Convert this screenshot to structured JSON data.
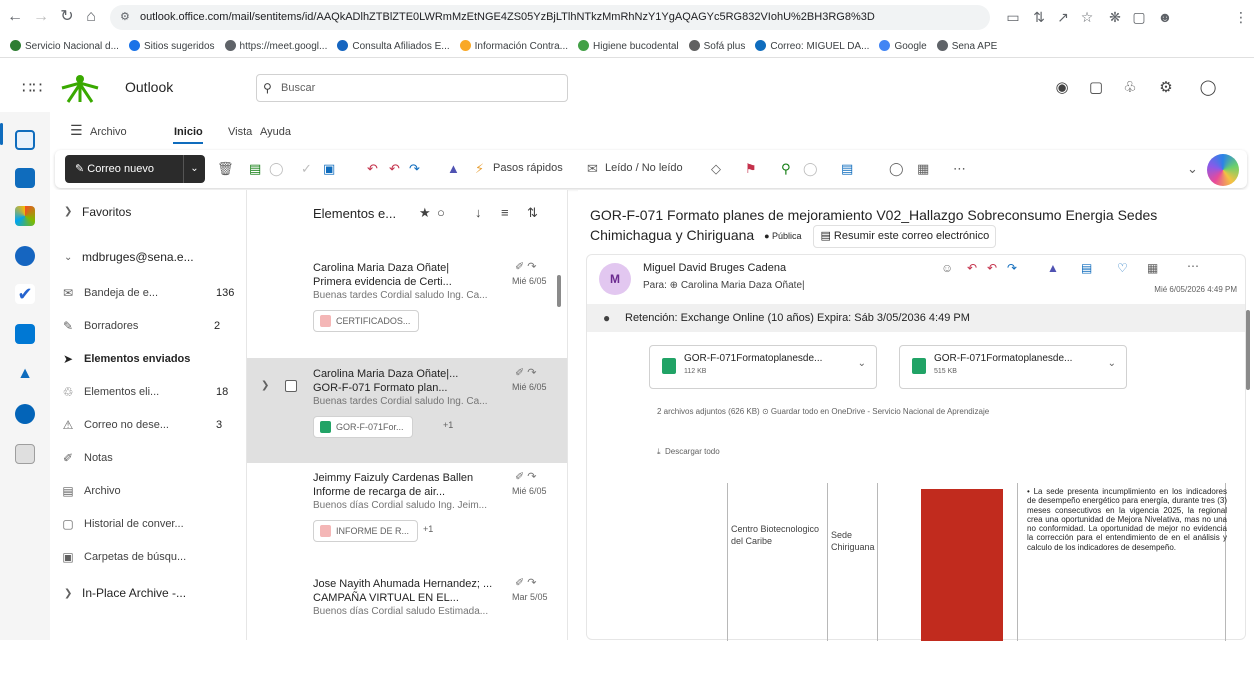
{
  "browser": {
    "url": "outlook.office.com/mail/sentitems/id/AAQkADlhZTBlZTE0LWRmMzEtNGE4ZS05YzBjLTlhNTkzMmRhNzY1YgAQAGYc5RG832VIohU%2BH3RG8%3D",
    "bookmarks": [
      {
        "label": "Servicio Nacional d...",
        "color": "#2e7d32"
      },
      {
        "label": "Sitios sugeridos",
        "color": "#1a73e8"
      },
      {
        "label": "https://meet.googl...",
        "color": "#5f6368"
      },
      {
        "label": "Consulta Afiliados E...",
        "color": "#1565c0"
      },
      {
        "label": "Información Contra...",
        "color": "#f9a825"
      },
      {
        "label": "Higiene bucodental",
        "color": "#43a047"
      },
      {
        "label": "Sofá plus",
        "color": "#616161"
      },
      {
        "label": "Correo: MIGUEL DA...",
        "color": "#0f6cbd"
      },
      {
        "label": "Google",
        "color": "#4285f4"
      },
      {
        "label": "Sena APE",
        "color": "#5f6368"
      }
    ]
  },
  "header": {
    "app_name": "Outlook",
    "search_placeholder": "Buscar"
  },
  "ribbon": {
    "tabs": [
      "Archivo",
      "Inicio",
      "Vista",
      "Ayuda"
    ],
    "new_mail": "Correo nuevo",
    "quick_steps": "Pasos rápidos",
    "read_unread": "Leído / No leído"
  },
  "folders": {
    "favorites": "Favoritos",
    "account": "mdbruges@sena.e...",
    "items": [
      {
        "label": "Bandeja de e...",
        "count": "136",
        "icon": "inbox-icon"
      },
      {
        "label": "Borradores",
        "count": "2",
        "icon": "drafts-icon"
      },
      {
        "label": "Elementos enviados",
        "count": "",
        "icon": "sent-icon"
      },
      {
        "label": "Elementos eli...",
        "count": "18",
        "icon": "trash-icon"
      },
      {
        "label": "Correo no dese...",
        "count": "3",
        "icon": "junk-icon"
      },
      {
        "label": "Notas",
        "count": "",
        "icon": "notes-icon"
      },
      {
        "label": "Archivo",
        "count": "",
        "icon": "archive-icon"
      },
      {
        "label": "Historial de conver...",
        "count": "",
        "icon": "history-icon"
      },
      {
        "label": "Carpetas de búsqu...",
        "count": "",
        "icon": "search-folder-icon"
      }
    ],
    "archive": "In-Place Archive -..."
  },
  "message_list": {
    "title": "Elementos e...",
    "messages": [
      {
        "from": "Carolina Maria Daza Oñate|",
        "subject": "Primera evidencia de Certi...",
        "date": "Mié 6/05",
        "preview": "Buenas tardes Cordial saludo Ing. Ca...",
        "attachment": "CERTIFICADOS...",
        "more": ""
      },
      {
        "from": "Carolina Maria Daza Oñate|...",
        "subject": "GOR-F-071 Formato plan...",
        "date": "Mié 6/05",
        "preview": "Buenas tardes Cordial saludo Ing. Ca...",
        "attachment": "GOR-F-071For...",
        "more": "+1"
      },
      {
        "from": "Jeimmy Faizuly Cardenas Ballen",
        "subject": "Informe de recarga de air...",
        "date": "Mié 6/05",
        "preview": "Buenos días Cordial saludo Ing. Jeim...",
        "attachment": "INFORME DE R...",
        "more": "+1"
      },
      {
        "from": "Jose Nayith Ahumada Hernandez; ...",
        "subject": "CAMPAÑA VIRTUAL EN EL...",
        "date": "Mar 5/05",
        "preview": "Buenos días Cordial saludo Estimada...",
        "attachment": "",
        "more": ""
      }
    ]
  },
  "reading": {
    "subject": "GOR-F-071 Formato planes de mejoramiento V02_Hallazgo Sobreconsumo Energia Sedes Chimichagua y  Chiriguana",
    "label": "Pública",
    "summarize": "Resumir este correo electrónico",
    "avatar_initial": "M",
    "sender": "Miguel David Bruges Cadena",
    "to": "Para: ⊕ Carolina Maria Daza Oñate|",
    "date": "Mié 6/05/2026 4:49 PM",
    "retention": "Retención: Exchange Online (10 años) Expira: Sáb 3/05/2036 4:49 PM",
    "attachments": [
      {
        "name": "GOR-F-071Formatoplanesde...",
        "size": "112 KB"
      },
      {
        "name": "GOR-F-071Formatoplanesde...",
        "size": "515 KB"
      }
    ],
    "attach_summary": "2 archivos adjuntos (626 KB)   ⊙ Guardar todo en OneDrive - Servicio Nacional de Aprendizaje",
    "download_all": "Descargar todo",
    "table": {
      "center": "Centro Biotecnologico del Caribe",
      "site": "Sede Chiriguana",
      "bar_color": "#c12b1e",
      "bullet": "La sede presenta incumplimiento en los indicadores de desempeño energético para energía, durante tres (3) meses consecutivos en la vigencia 2025, la regional crea una oportunidad de Mejora Nivelativa, mas no una no conformidad. La oportunidad de mejor no evidencia la corrección para el entendimiento de en el análisis y calculo de los indicadores de desempeño."
    }
  }
}
